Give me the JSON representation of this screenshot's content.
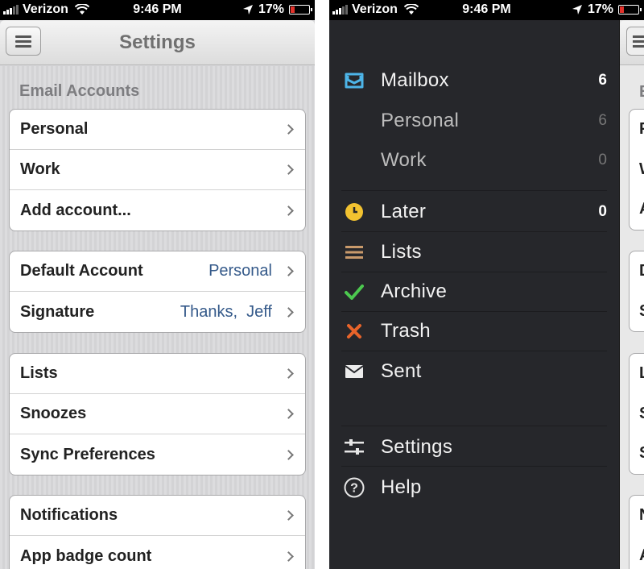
{
  "status_bar": {
    "carrier": "Verizon",
    "time": "9:46 PM",
    "battery": "17%"
  },
  "settings": {
    "title": "Settings",
    "email_accounts_header": "Email Accounts",
    "accounts": [
      {
        "label": "Personal"
      },
      {
        "label": "Work"
      },
      {
        "label": "Add account..."
      }
    ],
    "defaults": [
      {
        "label": "Default Account",
        "value": "Personal"
      },
      {
        "label": "Signature",
        "value": "Thanks,  Jeff"
      }
    ],
    "misc": [
      {
        "label": "Lists"
      },
      {
        "label": "Snoozes"
      },
      {
        "label": "Sync Preferences"
      }
    ],
    "alerts": [
      {
        "label": "Notifications"
      },
      {
        "label": "App badge count"
      }
    ]
  },
  "drawer": {
    "mailbox": {
      "label": "Mailbox",
      "count": "6",
      "icon": "mailbox-tray-icon",
      "color": "#4db5e8"
    },
    "personal": {
      "label": "Personal",
      "count": "6"
    },
    "work": {
      "label": "Work",
      "count": "0"
    },
    "later": {
      "label": "Later",
      "count": "0",
      "icon": "clock-icon",
      "color": "#f2c230"
    },
    "lists": {
      "label": "Lists",
      "icon": "list-icon",
      "color": "#c99a6b"
    },
    "archive": {
      "label": "Archive",
      "icon": "checkmark-icon",
      "color": "#4cc94f"
    },
    "trash": {
      "label": "Trash",
      "icon": "x-icon",
      "color": "#e8642a"
    },
    "sent": {
      "label": "Sent",
      "icon": "envelope-icon",
      "color": "#ececec"
    },
    "settings": {
      "label": "Settings",
      "icon": "sliders-icon"
    },
    "help": {
      "label": "Help",
      "icon": "question-circle-icon"
    }
  },
  "peek_letters": [
    "E",
    "P",
    "W",
    "A",
    "D",
    "S",
    "L",
    "S",
    "S",
    "N",
    "A"
  ]
}
